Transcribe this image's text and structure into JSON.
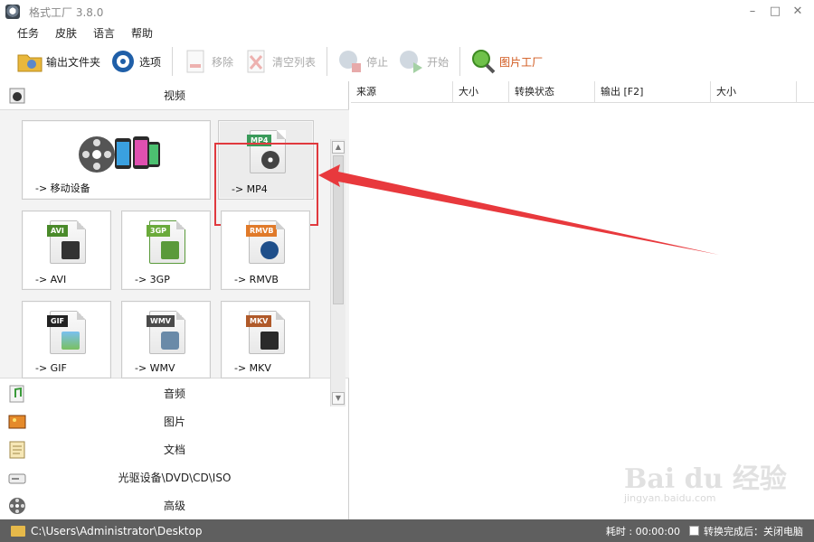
{
  "window": {
    "title": "格式工厂 3.8.0"
  },
  "menu": {
    "items": [
      "任务",
      "皮肤",
      "语言",
      "帮助"
    ]
  },
  "toolbar": {
    "output_folder": "输出文件夹",
    "options": "选项",
    "remove": "移除",
    "clear_list": "清空列表",
    "stop": "停止",
    "start": "开始",
    "picture_factory": "图片工厂"
  },
  "categories": {
    "video": "视频",
    "audio": "音频",
    "image": "图片",
    "document": "文档",
    "optical": "光驱设备\\DVD\\CD\\ISO",
    "advanced": "高级"
  },
  "video_tiles": [
    {
      "label": "-> 移动设备"
    },
    {
      "label": "-> MP4",
      "tag": "MP4"
    },
    {
      "label": "-> AVI",
      "tag": "AVI"
    },
    {
      "label": "-> 3GP",
      "tag": "3GP"
    },
    {
      "label": "-> RMVB",
      "tag": "RMVB"
    },
    {
      "label": "-> GIF",
      "tag": "GIF"
    },
    {
      "label": "-> WMV",
      "tag": "WMV"
    },
    {
      "label": "-> MKV",
      "tag": "MKV"
    }
  ],
  "table": {
    "columns": [
      "来源",
      "大小",
      "转换状态",
      "输出 [F2]",
      "大小"
    ]
  },
  "status": {
    "path": "C:\\Users\\Administrator\\Desktop",
    "elapsed": "耗时 : 00:00:00",
    "shutdown": "转换完成后：关闭电脑"
  },
  "watermark": {
    "brand": "Bai du 经验",
    "url": "jingyan.baidu.com"
  },
  "colors": {
    "highlight": "#e0393e",
    "statusbar": "#5f5f5f",
    "orange_text": "#d0561a"
  }
}
